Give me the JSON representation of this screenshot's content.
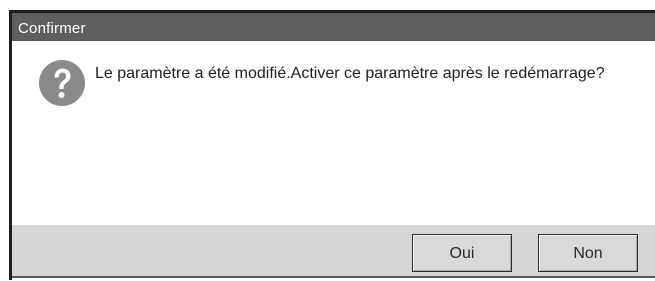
{
  "dialog": {
    "title": "Confirmer",
    "message": "Le paramètre a été modifié.Activer ce paramètre après le redémarrage?",
    "icon": "question-icon",
    "buttons": {
      "yes_label": "Oui",
      "no_label": "Non"
    }
  },
  "colors": {
    "title_bar": "#5e5e5e",
    "frame": "#1f1f1f",
    "button_bar": "#d6d6d6",
    "icon": "#8a8a8a"
  }
}
